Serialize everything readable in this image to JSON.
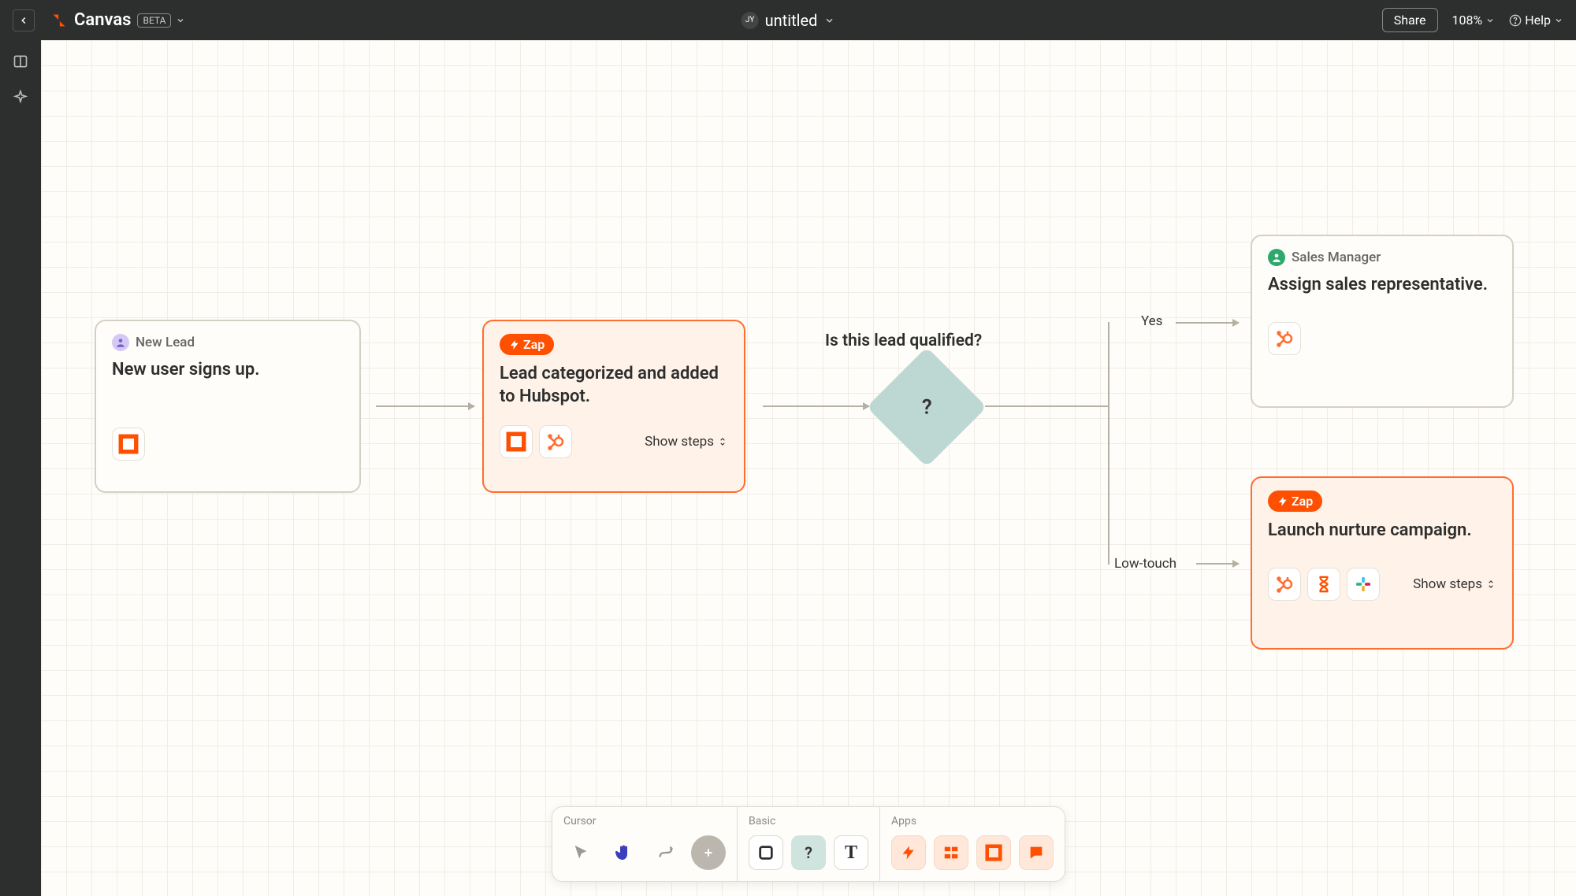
{
  "header": {
    "app_title": "Canvas",
    "beta": "BETA",
    "avatar_initials": "JY",
    "doc_title": "untitled",
    "share": "Share",
    "zoom": "108%",
    "help": "Help"
  },
  "nodes": {
    "n1": {
      "role": "New Lead",
      "title": "New user signs up."
    },
    "n2": {
      "badge": "Zap",
      "title": "Lead categorized and added to Hubspot.",
      "show_steps": "Show steps"
    },
    "decision": {
      "label": "Is this lead qualified?",
      "symbol": "?"
    },
    "n3": {
      "role": "Sales Manager",
      "title": "Assign sales representative."
    },
    "n4": {
      "badge": "Zap",
      "title": "Launch nurture campaign.",
      "show_steps": "Show steps"
    }
  },
  "edges": {
    "yes": "Yes",
    "low": "Low-touch"
  },
  "toolbar": {
    "cursor": "Cursor",
    "basic": "Basic",
    "apps": "Apps"
  }
}
